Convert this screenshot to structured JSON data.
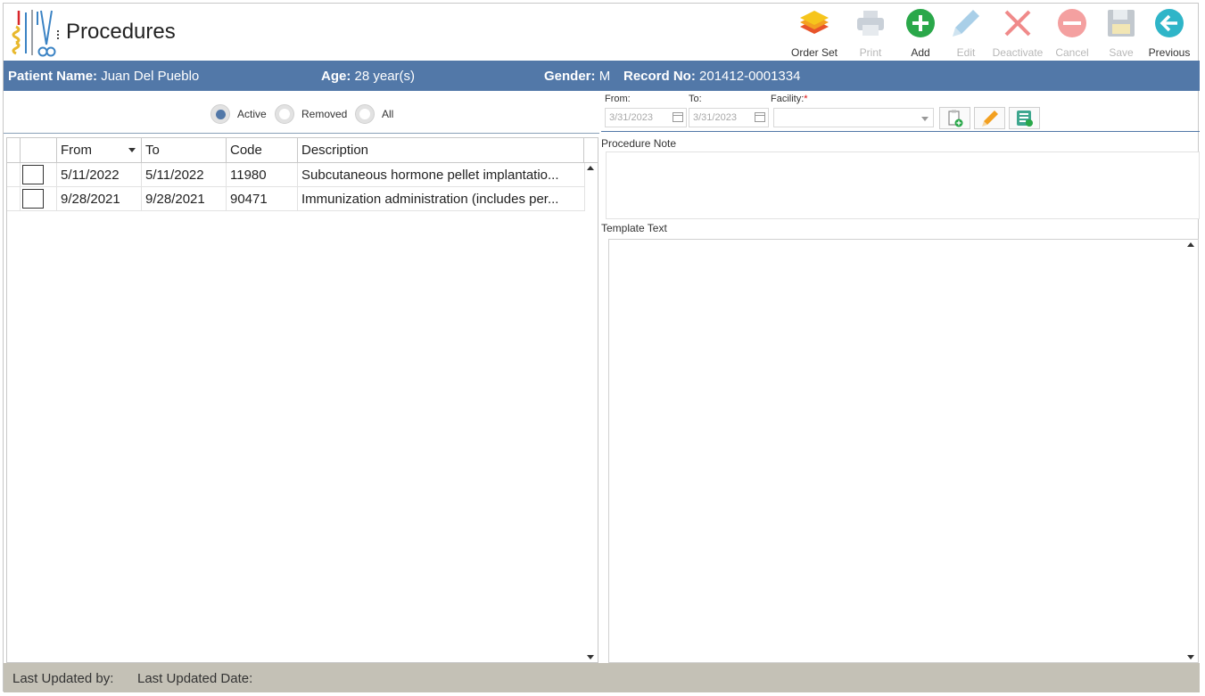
{
  "header": {
    "title": "Procedures",
    "toolbar": {
      "order_set": "Order Set",
      "print": "Print",
      "add": "Add",
      "edit": "Edit",
      "deactivate": "Deactivate",
      "cancel": "Cancel",
      "save": "Save",
      "previous": "Previous"
    }
  },
  "patient": {
    "name_label": "Patient Name:",
    "name": "Juan Del Pueblo",
    "age_label": "Age:",
    "age": "28 year(s)",
    "gender_label": "Gender:",
    "gender": "M",
    "record_label": "Record No:",
    "record": "201412-0001334"
  },
  "filter": {
    "active": "Active",
    "removed": "Removed",
    "all": "All",
    "selected": "Active"
  },
  "grid": {
    "columns": [
      "From",
      "To",
      "Code",
      "Description"
    ],
    "rows": [
      {
        "from": "5/11/2022",
        "to": "5/11/2022",
        "code": "11980",
        "description": "Subcutaneous hormone pellet implantatio..."
      },
      {
        "from": "9/28/2021",
        "to": "9/28/2021",
        "code": "90471",
        "description": "Immunization administration (includes per..."
      }
    ]
  },
  "details": {
    "from_label": "From:",
    "from_value": "3/31/2023",
    "to_label": "To:",
    "to_value": "3/31/2023",
    "facility_label": "Facility:",
    "facility_required": "*",
    "facility_value": "",
    "procedure_note_label": "Procedure Note",
    "procedure_note": "",
    "template_text_label": "Template Text",
    "template_text": ""
  },
  "footer": {
    "last_updated_by": "Last Updated by:",
    "last_updated_date": "Last Updated Date:"
  },
  "colors": {
    "patient_bar": "#5278a8",
    "add_green": "#2aa84a",
    "cancel_red": "#f08a8a",
    "previous_teal": "#2fb5c8",
    "footer": "#c4c1b6"
  }
}
